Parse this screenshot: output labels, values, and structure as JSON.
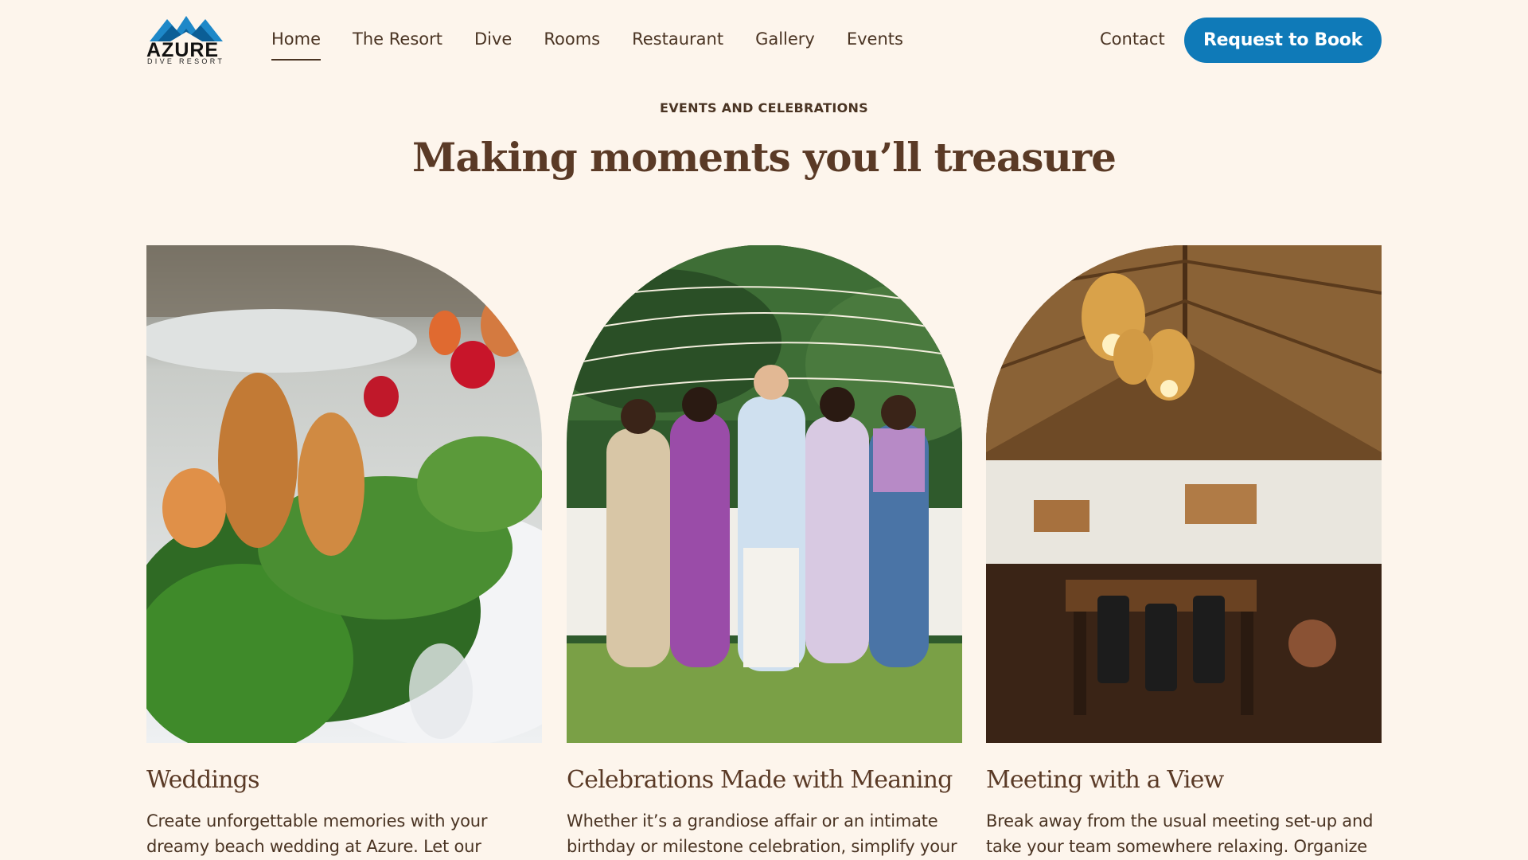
{
  "brand": {
    "name": "AZURE",
    "tagline": "DIVE RESORT",
    "logo_icon": "mountain-wave-icon",
    "accent_color": "#0f7ab8"
  },
  "nav": {
    "items": [
      {
        "label": "Home",
        "active": true
      },
      {
        "label": "The Resort",
        "active": false
      },
      {
        "label": "Dive",
        "active": false
      },
      {
        "label": "Rooms",
        "active": false
      },
      {
        "label": "Restaurant",
        "active": false
      },
      {
        "label": "Gallery",
        "active": false
      },
      {
        "label": "Events",
        "active": false
      }
    ],
    "contact": "Contact",
    "cta": "Request to Book"
  },
  "section": {
    "eyebrow": "EVENTS AND CELEBRATIONS",
    "title": "Making moments you’ll treasure"
  },
  "cards": [
    {
      "title": "Weddings",
      "description": "Create unforgettable memories with your dreamy beach wedding at Azure. Let our",
      "image": "tropical-floral-centerpiece-photo"
    },
    {
      "title": "Celebrations Made with Meaning",
      "description": "Whether it’s a grandiose affair or an intimate birthday or milestone celebration, simplify your",
      "image": "family-group-garden-party-photo"
    },
    {
      "title": "Meeting with a View",
      "description": "Break away from the usual meeting set-up and take your team somewhere relaxing. Organize",
      "image": "thatched-roof-dining-pavilion-photo"
    }
  ]
}
